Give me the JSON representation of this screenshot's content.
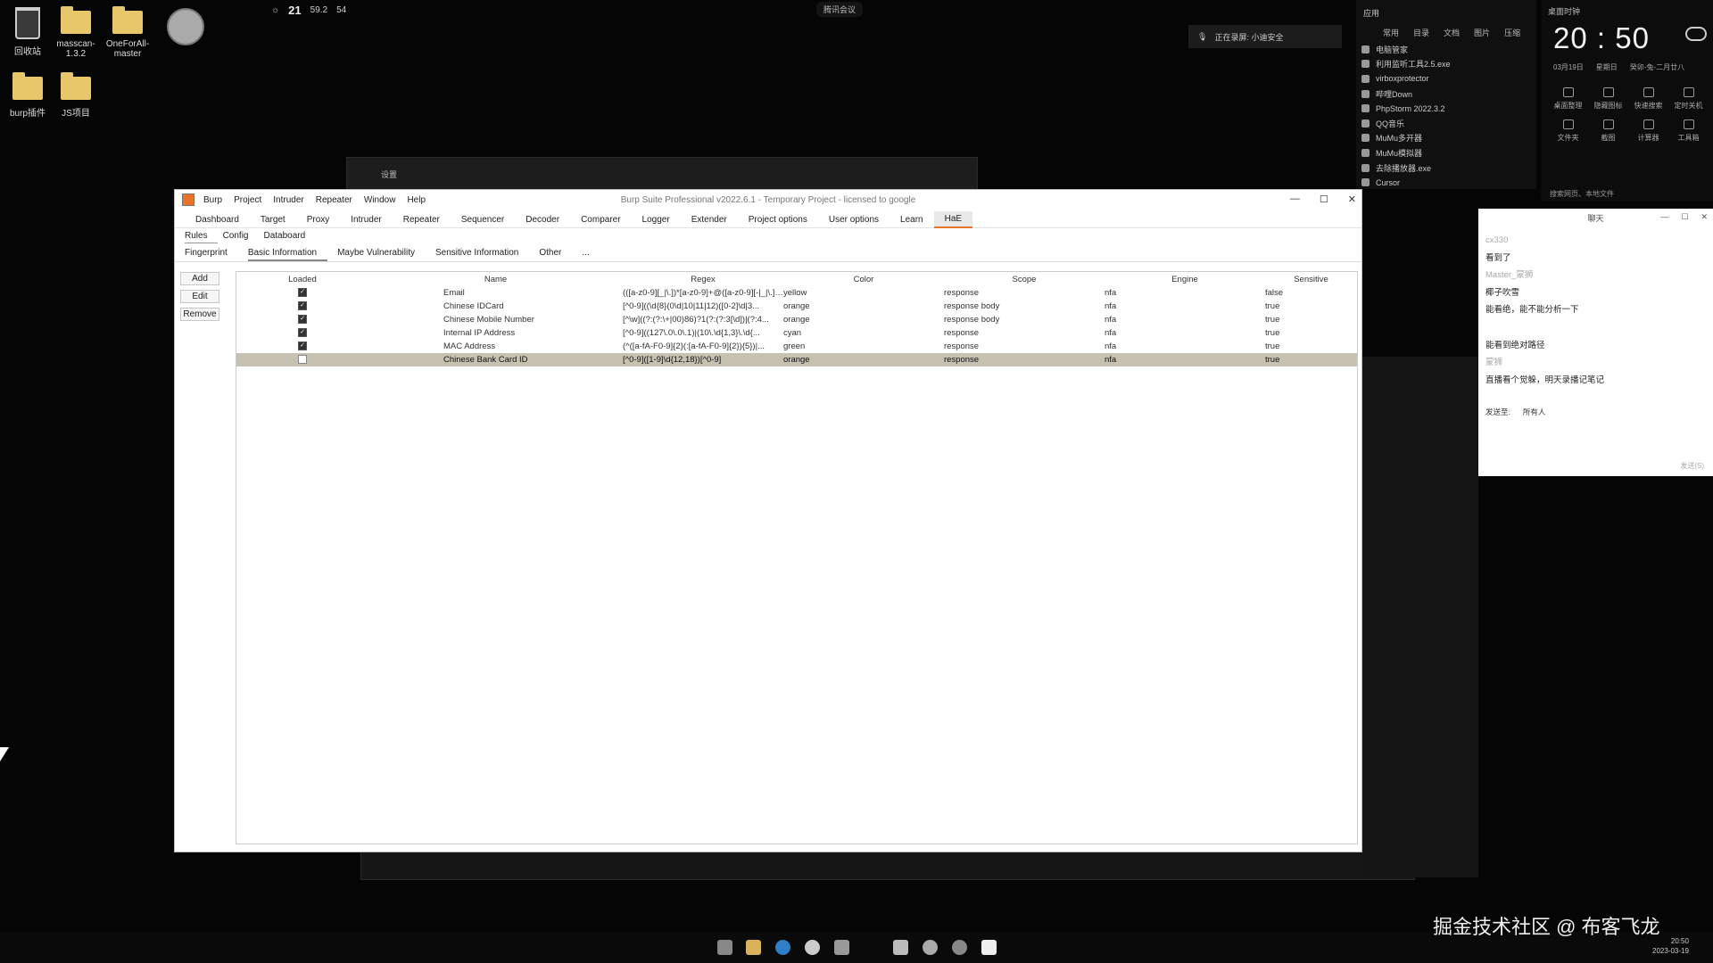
{
  "desktop": {
    "icons": [
      {
        "label": "回收站"
      },
      {
        "label": "masscan-1.3.2"
      },
      {
        "label": "OneForAll-master"
      },
      {
        "label": "burp插件"
      },
      {
        "label": "JS项目"
      }
    ],
    "weather": {
      "temp": "21",
      "aqi": "59.2",
      "sub": "54"
    },
    "top_center": "腾讯会议",
    "recording": "正在录屏: 小迪安全"
  },
  "apps_panel": {
    "title": "应用",
    "tabs": [
      "常用",
      "目录",
      "文档",
      "图片",
      "压缩"
    ],
    "items": [
      "电脑管家",
      "利用监听工具2.5.exe",
      "virboxprotector",
      "哔哩Down",
      "PhpStorm 2022.3.2",
      "QQ音乐",
      "MuMu多开器",
      "MuMu模拟器",
      "去除播放器.exe",
      "Cursor"
    ]
  },
  "clock_panel": {
    "title": "桌面时钟",
    "time": "20 : 50",
    "date": "03月19日",
    "weekday": "星期日",
    "lunar": "癸卯-兔-二月廿八",
    "quick": [
      "桌面整理",
      "隐藏图标",
      "快速搜索",
      "定时关机",
      "文件夹",
      "截图",
      "计算器",
      "工具箱"
    ],
    "search": "搜索网页、本地文件"
  },
  "burp": {
    "title": "Burp Suite Professional v2022.6.1 - Temporary Project - licensed to google",
    "menu": [
      "Burp",
      "Project",
      "Intruder",
      "Repeater",
      "Window",
      "Help"
    ],
    "main_tabs": [
      "Dashboard",
      "Target",
      "Proxy",
      "Intruder",
      "Repeater",
      "Sequencer",
      "Decoder",
      "Comparer",
      "Logger",
      "Extender",
      "Project options",
      "User options",
      "Learn",
      "HaE"
    ],
    "active_main_tab": "HaE",
    "sub_tabs": [
      "Rules",
      "Config",
      "Databoard"
    ],
    "rule_tabs": [
      "Fingerprint",
      "Basic Information",
      "Maybe Vulnerability",
      "Sensitive Information",
      "Other",
      "..."
    ],
    "buttons": {
      "add": "Add",
      "edit": "Edit",
      "remove": "Remove"
    },
    "columns": [
      "Loaded",
      "Name",
      "Regex",
      "Color",
      "Scope",
      "Engine",
      "Sensitive"
    ],
    "rows": [
      {
        "loaded": true,
        "name": "Email",
        "regex": "(([a-z0-9][_|\\.])*[a-z0-9]+@([a-z0-9][-|_|\\.])*...",
        "color": "yellow",
        "scope": "response",
        "engine": "nfa",
        "sensitive": "false"
      },
      {
        "loaded": true,
        "name": "Chinese IDCard",
        "regex": "[^0-9]((\\d{8}(0\\d|10|11|12)([0-2]\\d|3...",
        "color": "orange",
        "scope": "response body",
        "engine": "nfa",
        "sensitive": "true"
      },
      {
        "loaded": true,
        "name": "Chinese Mobile Number",
        "regex": "[^\\w]((?:(?:\\+|00)86)?1(?:(?:3[\\d])|(?:4...",
        "color": "orange",
        "scope": "response body",
        "engine": "nfa",
        "sensitive": "true"
      },
      {
        "loaded": true,
        "name": "Internal IP Address",
        "regex": "[^0-9]((127\\.0\\.0\\.1)|(10\\.\\d{1,3}\\.\\d{...",
        "color": "cyan",
        "scope": "response",
        "engine": "nfa",
        "sensitive": "true"
      },
      {
        "loaded": true,
        "name": "MAC Address",
        "regex": "(^([a-fA-F0-9]{2}(:[a-fA-F0-9]{2}){5})|...",
        "color": "green",
        "scope": "response",
        "engine": "nfa",
        "sensitive": "true"
      },
      {
        "loaded": false,
        "name": "Chinese Bank Card ID",
        "regex": "[^0-9]([1-9]\\d{12,18})[^0-9]",
        "color": "orange",
        "scope": "response",
        "engine": "nfa",
        "sensitive": "true",
        "selected": true
      }
    ]
  },
  "background_window": {
    "title": "设置"
  },
  "chat": {
    "title": "聊天",
    "messages": [
      {
        "text": "cx330",
        "dim": true
      },
      {
        "text": "看到了",
        "dim": false
      },
      {
        "text": "Master_蒙狮",
        "dim": true
      },
      {
        "text": "椰子吹雪",
        "dim": false
      },
      {
        "text": "能看绝，能不能分析一下",
        "dim": false
      },
      {
        "text": "",
        "dim": false
      },
      {
        "text": "能看到绝对路径",
        "dim": false
      },
      {
        "text": "蒙狮",
        "dim": true
      },
      {
        "text": "直播看个觉躲，明天录播记笔记",
        "dim": false
      }
    ],
    "send_to_label": "发送至:",
    "send_to_value": "所有人",
    "send_button": "发送(S)"
  },
  "taskbar": {
    "watermark": "掘金技术社区 @ 布客飞龙",
    "time": "20:50",
    "date": "2023-03-19"
  }
}
